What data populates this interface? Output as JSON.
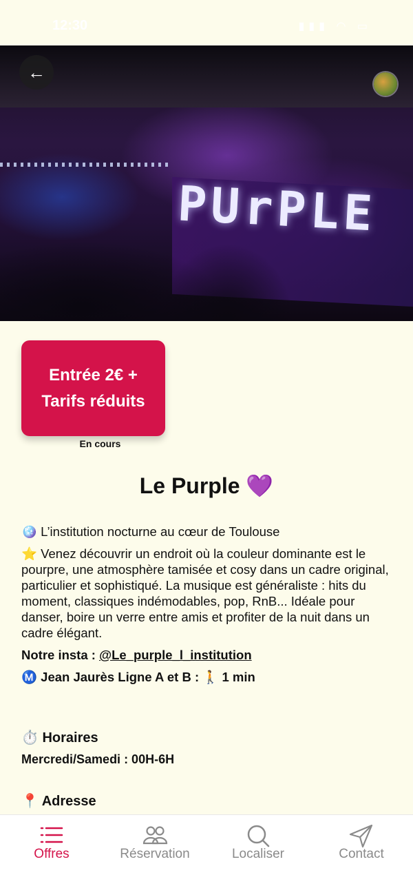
{
  "status_bar": {
    "time": "12:30",
    "icons": "▮▮▮ ◠ ▭"
  },
  "hero": {
    "sign_text": "PUrPLE"
  },
  "nav": {
    "back_icon": "←"
  },
  "promo": {
    "line1": "Entrée 2€ +",
    "line2": "Tarifs réduits",
    "status": "En cours",
    "accent_color": "#D4134A"
  },
  "place": {
    "title": "Le Purple  💜"
  },
  "description": {
    "tagline": "🪩 L’institution nocturne au cœur de Toulouse",
    "body": "⭐ Venez découvrir un endroit où la couleur dominante est le pourpre, une atmosphère tamisée et cosy dans un cadre original, particulier et sophistiqué. La musique est généraliste : hits du moment, classiques indémodables, pop, RnB... Idéale pour danser, boire un verre entre amis et profiter de la nuit dans un cadre élégant."
  },
  "insta": {
    "label": "Notre insta : ",
    "handle": "@Le_purple_l_institution"
  },
  "metro": {
    "text": "Ⓜ️ Jean Jaurès Ligne A et B : 🚶 1 min"
  },
  "hours": {
    "title": "⏱️ Horaires",
    "value": "Mercredi/Samedi : 00H-6H"
  },
  "address": {
    "title": "📍 Adresse"
  },
  "tabbar": {
    "tabs": [
      {
        "label": "Offres",
        "icon": "list-icon",
        "active": true
      },
      {
        "label": "Réservation",
        "icon": "users-icon",
        "active": false
      },
      {
        "label": "Localiser",
        "icon": "search-icon",
        "active": false
      },
      {
        "label": "Contact",
        "icon": "send-icon",
        "active": false
      }
    ]
  }
}
